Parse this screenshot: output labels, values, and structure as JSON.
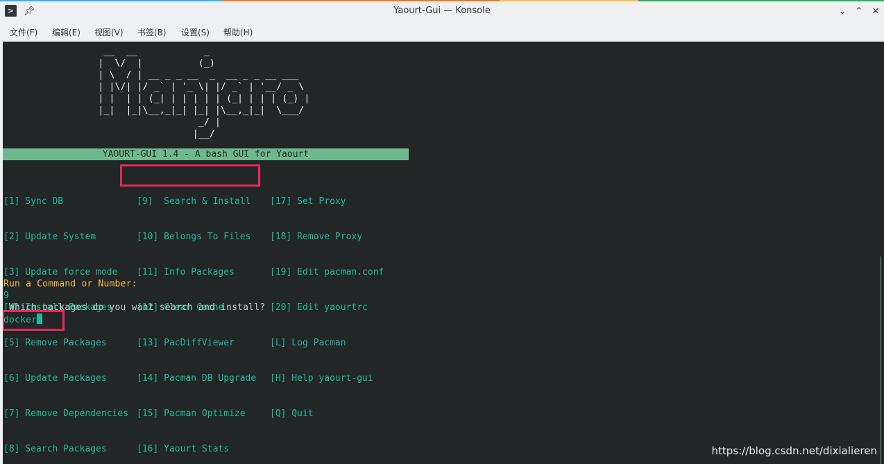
{
  "window": {
    "title": "Yaourt-Gui — Konsole",
    "accent_colors": [
      "#3daee9",
      "#e74c3c",
      "#fdbc4b",
      "#27ae60"
    ]
  },
  "menubar": {
    "items": [
      "文件(F)",
      "编辑(E)",
      "视图(V)",
      "书签(B)",
      "设置(S)",
      "帮助(H)"
    ]
  },
  "terminal": {
    "ascii_logo": [
      "                  __  __            _",
      "                 |  \\/  |          (_)",
      "                 | \\  / | __ _ _ __  _  __ _ _ __ ___",
      "                 | |\\/| |/ _` | '_ \\| |/ _` | '__/ _ \\",
      "                 | |  | | (_| | | | | | (_| | | | (_) |",
      "                 |_|  |_|\\__,_|_| |_| |\\__,_|_|  \\___/",
      "                                   _/ |",
      "                                  |__/"
    ],
    "banner": "YAOURT-GUI 1.4 - A bash GUI for Yaourt",
    "menu_col1": [
      "[1] Sync DB",
      "[2] Update System",
      "[3] Update force mode",
      "[4] Install Packages",
      "[5] Remove Packages",
      "[6] Update Packages",
      "[7] Remove Dependencies",
      "[8] Search Packages"
    ],
    "menu_col2": [
      "[9]  Search & Install",
      "[10] Belongs To Files",
      "[11] Info Packages",
      "[12] Clear Cache",
      "[13] PacDiffViewer",
      "[14] Pacman DB Upgrade",
      "[15] Pacman Optimize",
      "[16] Yaourt Stats"
    ],
    "menu_col3": [
      "[17] Set Proxy",
      "[18] Remove Proxy",
      "[19] Edit pacman.conf",
      "[20] Edit yaourtrc",
      "[L] Log Pacman",
      "[H] Help yaourt-gui",
      "[Q] Quit"
    ],
    "prompt": "Run a Command or Number:",
    "entered_number": "9",
    "question": " Which packages do you want search and install?",
    "input_value": "docker"
  },
  "watermark": "https://blog.csdn.net/dixialieren"
}
